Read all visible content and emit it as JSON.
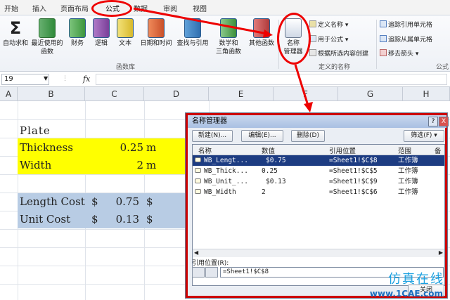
{
  "tabs": [
    "开始",
    "插入",
    "页面布局",
    "公式",
    "数据",
    "审阅",
    "视图"
  ],
  "ribbon": {
    "buttons": [
      {
        "label": "自动求和",
        "icon": "sigma-icon"
      },
      {
        "label": "最近使用的\n函数",
        "icon": "book-icon"
      },
      {
        "label": "财务",
        "icon": "book-icon"
      },
      {
        "label": "逻辑",
        "icon": "book-icon"
      },
      {
        "label": "文本",
        "icon": "book-icon"
      },
      {
        "label": "日期和时间",
        "icon": "book-icon"
      },
      {
        "label": "查找与引用",
        "icon": "book-icon"
      },
      {
        "label": "数学和\n三角函数",
        "icon": "book-icon"
      },
      {
        "label": "其他函数",
        "icon": "book-icon"
      }
    ],
    "group_library": "函数库",
    "name_manager": "名称\n管理器",
    "defined": [
      "定义名称 ▾",
      "用于公式 ▾",
      "根据所选内容创建"
    ],
    "group_defined": "定义的名称",
    "audit": [
      "追踪引用单元格",
      "追踪从属单元格",
      "移去箭头 ▾"
    ],
    "group_audit": "公式"
  },
  "formula_bar": {
    "namebox": "19",
    "fx": "fx"
  },
  "columns": [
    "A",
    "B",
    "C",
    "D",
    "E",
    "F",
    "G",
    "H"
  ],
  "sheet": {
    "title": "Plate",
    "thickness_label": "Thickness",
    "thickness_value": "0.25",
    "thickness_unit": "m",
    "width_label": "Width",
    "width_value": "2",
    "width_unit": "m",
    "length_cost_label": "Length Cost",
    "length_cost_currency": "$",
    "length_cost_value": "0.75",
    "length_cost_unit": "$",
    "unit_cost_label": "Unit Cost",
    "unit_cost_currency": "$",
    "unit_cost_value": "0.13",
    "unit_cost_unit": "$"
  },
  "dialog": {
    "title": "名称管理器",
    "help": "?",
    "close": "X",
    "new": "新建(N)...",
    "edit": "编辑(E)...",
    "delete": "删除(D)",
    "filter": "筛选(F) ▾",
    "headers": [
      "名称",
      "数值",
      "引用位置",
      "范围",
      "备"
    ],
    "rows": [
      {
        "name": "WB_Lengt...",
        "value": "$0.75",
        "ref": "=Sheet1!$C$8",
        "scope": "工作簿"
      },
      {
        "name": "WB_Thick...",
        "value": "0.25",
        "ref": "=Sheet1!$C$5",
        "scope": "工作簿"
      },
      {
        "name": "WB_Unit_...",
        "value": "$0.13",
        "ref": "=Sheet1!$C$9",
        "scope": "工作簿"
      },
      {
        "name": "WB_Width",
        "value": "2",
        "ref": "=Sheet1!$C$6",
        "scope": "工作簿"
      }
    ],
    "ref_label": "引用位置(R):",
    "ref_value": "=Sheet1!$C$8",
    "close_btn": "关闭"
  },
  "watermark": {
    "cn": "仿真在线",
    "url": "www.1CAE.com"
  },
  "colors": {
    "yellow": "#ffff00",
    "blue": "#b8cce4",
    "select": "#1d3c82",
    "annotation": "#e00000"
  }
}
